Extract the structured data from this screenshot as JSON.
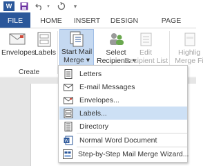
{
  "quick_access": {
    "app_logo": "W",
    "icons": [
      "word-logo-icon",
      "save-icon",
      "undo-icon",
      "redo-icon",
      "customize-icon"
    ]
  },
  "tabs": [
    {
      "label": "FILE"
    },
    {
      "label": "HOME"
    },
    {
      "label": "INSERT"
    },
    {
      "label": "DESIGN"
    },
    {
      "label": "PAGE LAYOUT"
    }
  ],
  "ribbon": {
    "envelopes": "Envelopes",
    "labels": "Labels",
    "start_mail_merge_line1": "Start Mail",
    "start_mail_merge_line2": "Merge",
    "select_recipients_line1": "Select",
    "select_recipients_line2": "Recipients",
    "edit_recipient_line1": "Edit",
    "edit_recipient_line2": "Recipient List",
    "highlight_line1": "Highlig",
    "highlight_line2": "Merge Fi",
    "create_group": "Create",
    "dropdown_arrow": "▾"
  },
  "menu": {
    "items": [
      {
        "label": "Letters",
        "icon": "letter-icon"
      },
      {
        "label": "E-mail Messages",
        "icon": "email-icon"
      },
      {
        "label": "Envelopes...",
        "icon": "envelope-icon"
      },
      {
        "label": "Labels...",
        "icon": "labels-icon"
      },
      {
        "label": "Directory",
        "icon": "directory-icon"
      },
      {
        "label": "Normal Word Document",
        "icon": "word-document-icon"
      },
      {
        "label": "Step-by-Step Mail Merge Wizard...",
        "icon": "wizard-icon"
      }
    ]
  },
  "colors": {
    "word_blue": "#2b579a",
    "selected_button": "#c5d9f1",
    "menu_hover": "#cde0f5"
  }
}
